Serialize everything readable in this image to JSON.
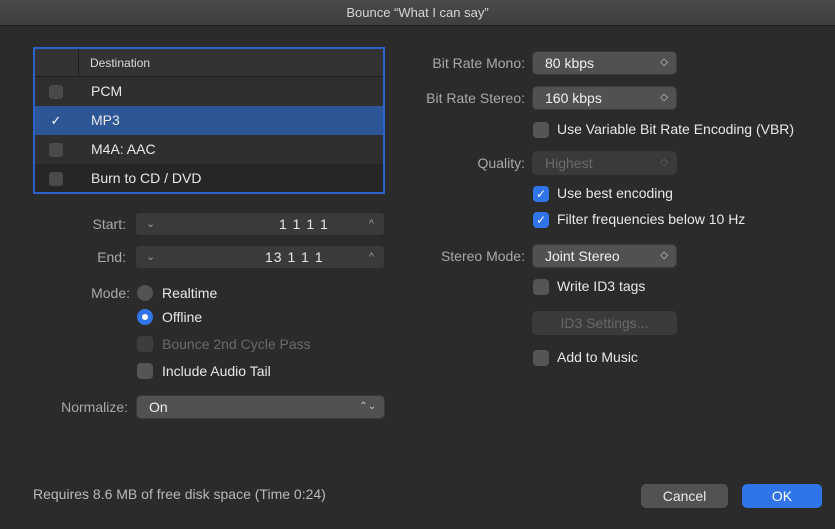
{
  "window": {
    "title": "Bounce “What I can say”"
  },
  "destination": {
    "header": "Destination",
    "items": [
      {
        "label": "PCM",
        "checked": false
      },
      {
        "label": "MP3",
        "checked": true
      },
      {
        "label": "M4A: AAC",
        "checked": false
      },
      {
        "label": "Burn to CD / DVD",
        "checked": false
      }
    ],
    "check_glyph": "✓"
  },
  "range": {
    "start_label": "Start:",
    "start_value": "1  1  1     1",
    "end_label": "End:",
    "end_value": "13  1  1     1",
    "down_glyph": "⌄",
    "up_glyph": "^"
  },
  "mode": {
    "label": "Mode:",
    "realtime": "Realtime",
    "offline": "Offline",
    "bounce_cycle": "Bounce 2nd Cycle Pass",
    "include_tail": "Include Audio Tail"
  },
  "normalize": {
    "label": "Normalize:",
    "value": "On"
  },
  "encoding": {
    "bitrate_mono_label": "Bit Rate Mono:",
    "bitrate_mono_value": "80 kbps",
    "bitrate_stereo_label": "Bit Rate Stereo:",
    "bitrate_stereo_value": "160 kbps",
    "vbr_label": "Use Variable Bit Rate Encoding (VBR)",
    "quality_label": "Quality:",
    "quality_value": "Highest",
    "best_encoding_label": "Use best encoding",
    "filter_label": "Filter frequencies below 10 Hz",
    "stereo_mode_label": "Stereo Mode:",
    "stereo_mode_value": "Joint Stereo",
    "id3_tags_label": "Write ID3 tags",
    "id3_settings_button": "ID3 Settings...",
    "add_music_label": "Add to Music"
  },
  "footer": {
    "disk_space": "Requires 8.6 MB of free disk space  (Time 0:24)",
    "cancel": "Cancel",
    "ok": "OK"
  },
  "popup_arrow_glyph": "⌃⌄",
  "colors": {
    "accent": "#2f74e8",
    "selection": "#2d5696",
    "background": "#2b2b2c"
  }
}
